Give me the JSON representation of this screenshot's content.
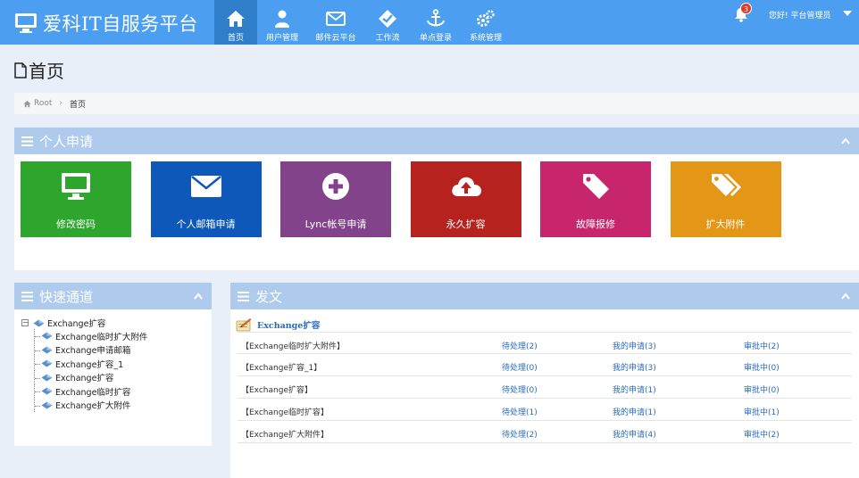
{
  "brand": {
    "title": "爱科IT自服务平台",
    "icon": "monitor-icon"
  },
  "nav": [
    {
      "label": "首页",
      "icon": "home-icon",
      "active": true
    },
    {
      "label": "用户管理",
      "icon": "users-icon",
      "active": false
    },
    {
      "label": "邮件云平台",
      "icon": "envelope-icon",
      "active": false
    },
    {
      "label": "工作流",
      "icon": "check-badge-icon",
      "active": false
    },
    {
      "label": "单点登录",
      "icon": "anchor-icon",
      "active": false
    },
    {
      "label": "系统管理",
      "icon": "gears-icon",
      "active": false
    }
  ],
  "header": {
    "notification_count": "3",
    "greeting": "您好! 平台管理员"
  },
  "page": {
    "title": "首页"
  },
  "breadcrumb": {
    "root": "Root",
    "current": "首页"
  },
  "personal": {
    "title": "个人申请",
    "tiles": [
      {
        "label": "修改密码",
        "icon": "monitor-icon",
        "color": "#2ea52d"
      },
      {
        "label": "个人邮箱申请",
        "icon": "envelope-icon",
        "color": "#0d58b9"
      },
      {
        "label": "Lync帐号申请",
        "icon": "plus-circle-icon",
        "color": "#83438b"
      },
      {
        "label": "永久扩容",
        "icon": "cloud-upload-icon",
        "color": "#b6221e"
      },
      {
        "label": "故障报修",
        "icon": "tag-icon",
        "color": "#c8266c"
      },
      {
        "label": "扩大附件",
        "icon": "tags-icon",
        "color": "#e49616"
      }
    ]
  },
  "quick": {
    "title": "快速通道",
    "root": "Exchange扩容",
    "items": [
      "Exchange临时扩大附件",
      "Exchange申请邮箱",
      "Exchange扩容_1",
      "Exchange扩容",
      "Exchange临时扩容",
      "Exchange扩大附件"
    ]
  },
  "docs": {
    "title": "发文",
    "group": "Exchange扩容",
    "rows": [
      {
        "name": "【Exchange临时扩大附件】",
        "pending": "待处理(2)",
        "mine": "我的申请(3)",
        "approving": "审批中(2)"
      },
      {
        "name": "【Exchange扩容_1】",
        "pending": "待处理(0)",
        "mine": "我的申请(3)",
        "approving": "审批中(0)"
      },
      {
        "name": "【Exchange扩容】",
        "pending": "待处理(0)",
        "mine": "我的申请(1)",
        "approving": "审批中(0)"
      },
      {
        "name": "【Exchange临时扩容】",
        "pending": "待处理(1)",
        "mine": "我的申请(1)",
        "approving": "审批中(1)"
      },
      {
        "name": "【Exchange扩大附件】",
        "pending": "待处理(2)",
        "mine": "我的申请(4)",
        "approving": "审批中(2)"
      }
    ]
  }
}
